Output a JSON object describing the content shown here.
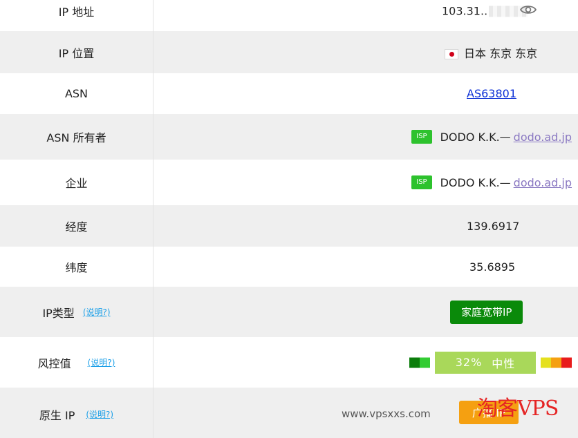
{
  "rows": {
    "ip_address": {
      "label": "IP 地址",
      "value": "103.31.."
    },
    "ip_location": {
      "label": "IP 位置",
      "value": "日本 东京 东京"
    },
    "asn": {
      "label": "ASN",
      "value": "AS63801"
    },
    "asn_owner": {
      "label": "ASN 所有者",
      "badge": "ISP",
      "name": "DODO K.K.—",
      "domain": "dodo.ad.jp"
    },
    "enterprise": {
      "label": "企业",
      "badge": "ISP",
      "name": "DODO K.K.—",
      "domain": "dodo.ad.jp"
    },
    "longitude": {
      "label": "经度",
      "value": "139.6917"
    },
    "latitude": {
      "label": "纬度",
      "value": "35.6895"
    },
    "ip_type": {
      "label": "IP类型",
      "help": "(说明?)",
      "value": "家庭宽带IP"
    },
    "risk": {
      "label": "风控值",
      "help": "(说明?)",
      "percent": "32%",
      "level": "中性",
      "score": 0.32
    },
    "native_ip": {
      "label": "原生 IP",
      "help": "(说明?)",
      "value": "广播 IP"
    }
  },
  "watermark": {
    "site": "www.vpsxxs.com",
    "brand": "淘客VPS"
  },
  "colors": {
    "accent_green": "#0a8a0a",
    "isp_badge": "#2dc22d",
    "risk_bar": "#a9d85a",
    "broadcast": "#f5a011",
    "link_blue": "#0b2fd6",
    "domain_purple": "#8a78c2"
  },
  "icons": {
    "reveal": "eye-icon",
    "flag": "japan-flag-icon"
  }
}
